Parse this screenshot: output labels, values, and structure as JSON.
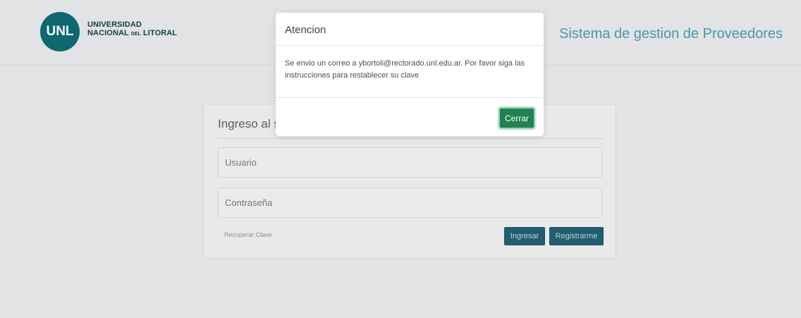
{
  "header": {
    "logo_abbrev": "UNL",
    "university_line_1": "UNIVERSIDAD",
    "university_line_2_prefix": "NACIONAL",
    "university_line_2_small": "DEL",
    "university_line_2_suffix": "LITORAL",
    "system_title": "Sistema de gestion de Proveedores"
  },
  "login": {
    "title": "Ingreso al sis",
    "username_placeholder": "Usuario",
    "password_placeholder": "Contraseña",
    "recover_link": "Recuperar Clave",
    "login_button": "Ingresar",
    "register_button": "Registrarme"
  },
  "modal": {
    "title": "Atencion",
    "message": "Se envio un correo a ybortoli@rectorado.unl.edu.ar. Por favor siga las instrucciones para restablecer su clave",
    "close_button": "Cerrar"
  },
  "colors": {
    "brand_teal": "#0e6b72",
    "title_blue": "#4d9bb0",
    "button_dark_blue": "#235f73",
    "modal_green": "#1f8251"
  }
}
